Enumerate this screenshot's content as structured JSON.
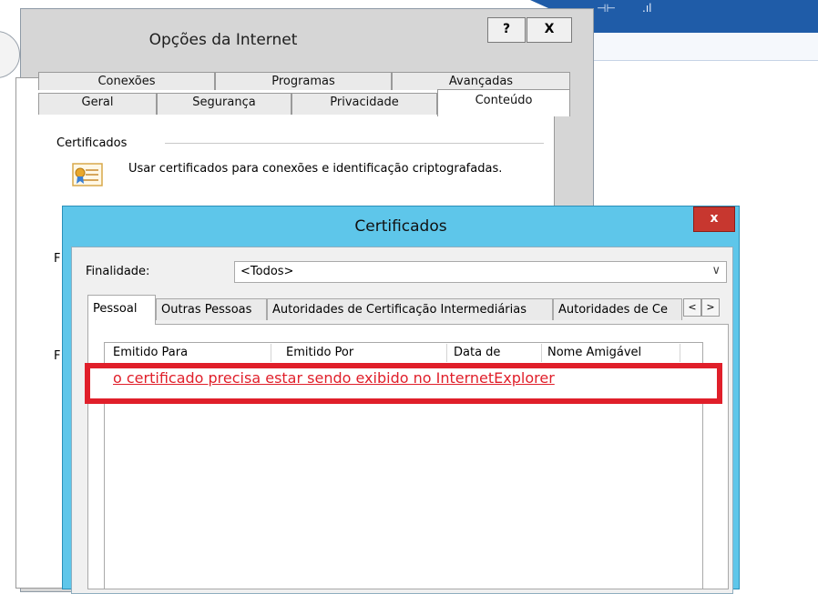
{
  "background": {
    "status_indicators": [
      "⊣⊢",
      ".ıl"
    ]
  },
  "internet_options": {
    "title": "Opções da Internet",
    "help_label": "?",
    "close_label": "X",
    "tabs_back": [
      "Conexões",
      "Programas",
      "Avançadas"
    ],
    "tabs_front": [
      "Geral",
      "Segurança",
      "Privacidade",
      "Conteúdo"
    ],
    "active_tab": "Conteúdo",
    "certificates_section": {
      "title": "Certificados",
      "description": "Usar certificados para conexões e identificação criptografadas."
    },
    "partial_labels": [
      "F",
      "F"
    ]
  },
  "certificates_dialog": {
    "title": "Certificados",
    "close_label": "x",
    "purpose_label": "Finalidade:",
    "purpose_value": "<Todos>",
    "tabs": [
      "Pessoal",
      "Outras Pessoas",
      "Autoridades de Certificação Intermediárias",
      "Autoridades de Ce"
    ],
    "scroll_left": "<",
    "scroll_right": ">",
    "columns": [
      "Emitido Para",
      "Emitido Por",
      "Data de",
      "Nome Amigável"
    ]
  },
  "annotation": {
    "text": "o certificado precisa estar sendo exibido no InternetExplorer",
    "color": "#e01f2a"
  }
}
